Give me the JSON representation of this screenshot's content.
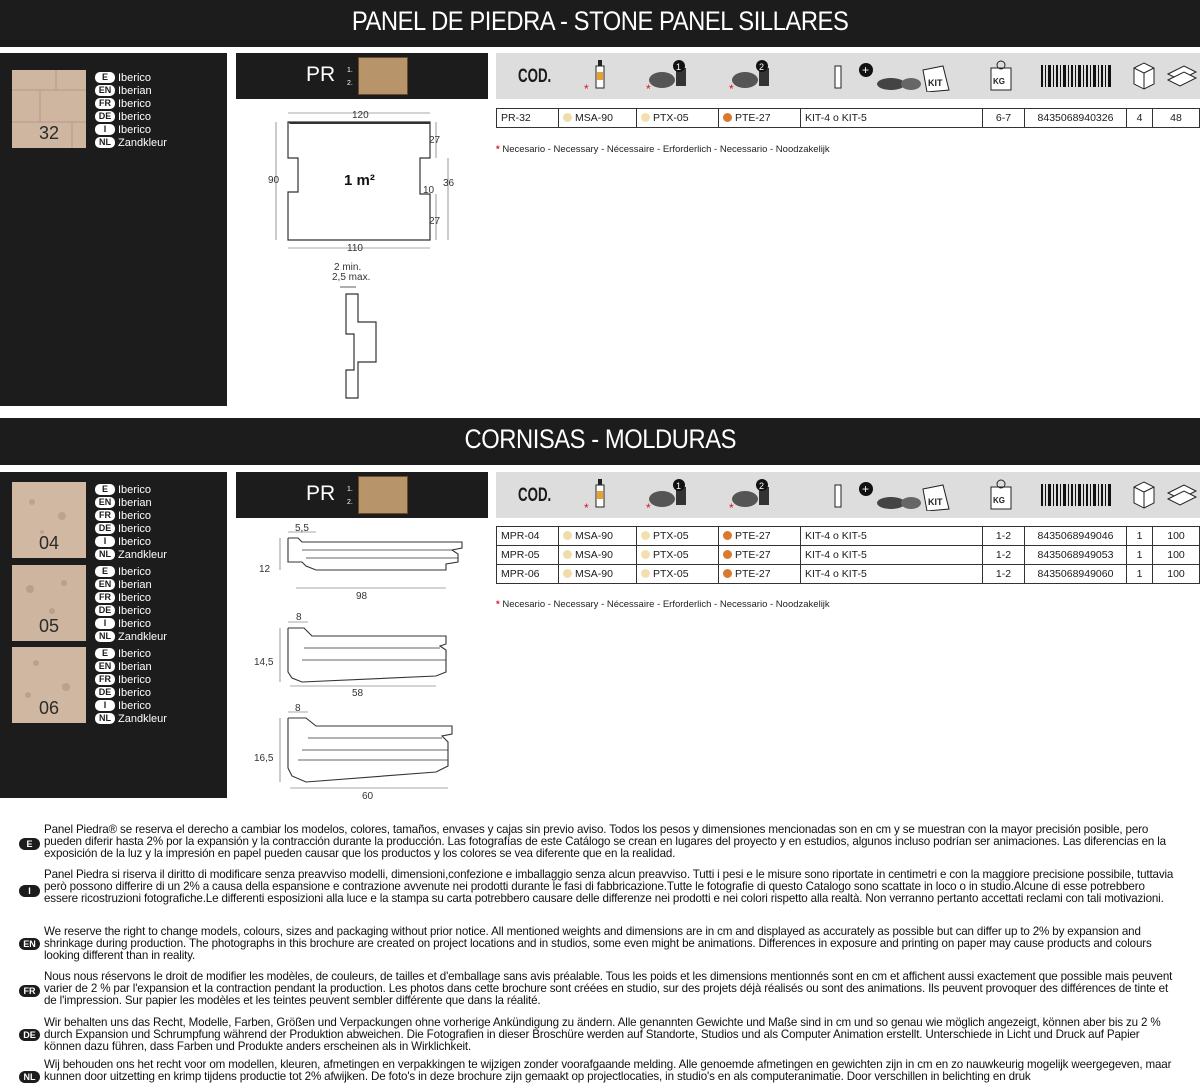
{
  "section1": {
    "title": "PANEL DE PIEDRA - STONE PANEL SILLARES",
    "swatch": {
      "number": "32"
    },
    "languages": [
      {
        "code": "E",
        "name": "Iberico"
      },
      {
        "code": "EN",
        "name": "Iberian"
      },
      {
        "code": "FR",
        "name": "Iberico"
      },
      {
        "code": "DE",
        "name": "Iberico"
      },
      {
        "code": "I",
        "name": "Iberico"
      },
      {
        "code": "NL",
        "name": "Zandkleur"
      }
    ],
    "pr_label": "PR",
    "pr_markers": [
      "1.",
      "2."
    ],
    "drawing": {
      "area": "1 m²",
      "width_top": "120",
      "width_bottom": "110",
      "height": "90",
      "right_top": "27",
      "right_mid": "36",
      "right_inner": "10",
      "right_bottom": "27",
      "joint_min": "2 min.",
      "joint_max": "2,5 max."
    },
    "rows": [
      {
        "code": "PR-32",
        "c1": "MSA-90",
        "c2": "PTX-05",
        "c3": "PTE-27",
        "kit": "KIT-4 o KIT-5",
        "kg": "6-7",
        "ean": "8435068940326",
        "box": "4",
        "pallet": "48"
      }
    ],
    "footnote": "Necesario - Necessary - Nécessaire - Erforderlich - Necessario - Noodzakelijk"
  },
  "section2": {
    "title": "CORNISAS - MOLDURAS",
    "swatches": [
      {
        "number": "04"
      },
      {
        "number": "05"
      },
      {
        "number": "06"
      }
    ],
    "languages": [
      {
        "code": "E",
        "name": "Iberico"
      },
      {
        "code": "EN",
        "name": "Iberian"
      },
      {
        "code": "FR",
        "name": "Iberico"
      },
      {
        "code": "DE",
        "name": "Iberico"
      },
      {
        "code": "I",
        "name": "Iberico"
      },
      {
        "code": "NL",
        "name": "Zandkleur"
      }
    ],
    "pr_label": "PR",
    "pr_markers": [
      "1.",
      "2."
    ],
    "profiles": [
      {
        "top": "5,5",
        "height": "12",
        "length": "98"
      },
      {
        "top": "8",
        "height": "14,5",
        "length": "58"
      },
      {
        "top": "8",
        "height": "16,5",
        "length": "60"
      }
    ],
    "rows": [
      {
        "code": "MPR-04",
        "c1": "MSA-90",
        "c2": "PTX-05",
        "c3": "PTE-27",
        "kit": "KIT-4 o KIT-5",
        "kg": "1-2",
        "ean": "8435068949046",
        "box": "1",
        "pallet": "100"
      },
      {
        "code": "MPR-05",
        "c1": "MSA-90",
        "c2": "PTX-05",
        "c3": "PTE-27",
        "kit": "KIT-4 o KIT-5",
        "kg": "1-2",
        "ean": "8435068949053",
        "box": "1",
        "pallet": "100"
      },
      {
        "code": "MPR-06",
        "c1": "MSA-90",
        "c2": "PTX-05",
        "c3": "PTE-27",
        "kit": "KIT-4 o KIT-5",
        "kg": "1-2",
        "ean": "8435068949060",
        "box": "1",
        "pallet": "100"
      }
    ],
    "footnote": "Necesario - Necessary - Nécessaire - Erforderlich - Necessario - Noodzakelijk"
  },
  "icon_bar": {
    "cod": "COD.",
    "icons": [
      "adhesive-tube-icon",
      "paint-step-1-icon",
      "paint-step-2-icon",
      "kit-icon",
      "weight-icon",
      "barcode-icon",
      "box-icon",
      "pallet-icon"
    ],
    "kit_label": "KIT",
    "kg_label": "KG",
    "step1": "1",
    "step2": "2"
  },
  "colors": {
    "dark": "#1c1c1c",
    "msa": "#f0dca8",
    "ptx": "#f2e0b0",
    "pte": "#d9792e",
    "required": "#dd1122"
  },
  "disclaimers": [
    {
      "code": "E",
      "text": "Panel Piedra® se reserva el derecho a cambiar los modelos, colores, tamaños, envases y cajas sin previo aviso. Todos los pesos y dimensiones mencionadas son en cm y se muestran con la mayor precisión posible, pero pueden diferir hasta 2% por la expansión y la contracción durante la producción. Las fotografías de este Catálogo se crean en lugares del proyecto y en estudios, algunos incluso podrían ser animaciones. Las diferencias en la exposición de la luz y la impresión en papel pueden causar que los productos y los colores se vea diferente que en la realidad."
    },
    {
      "code": "I",
      "text": "Panel Piedra si riserva il diritto di modificare senza preavviso modelli, dimensioni,confezione e imballaggio senza alcun preavviso. Tutti i pesi e le misure sono riportate in centimetri e con la maggiore precisione possibile, tuttavia però possono differire di un 2% a causa della espansione e contrazione avvenute nei prodotti durante le fasi di fabbricazione.Tutte le fotografie di questo Catalogo sono scattate in loco o in studio.Alcune di esse potrebbero essere ricostruzioni fotografiche.Le differenti esposizioni alla luce e la stampa su carta potrebbero causare delle differenze nei prodotti e nei colori rispetto alla realtà. Non verranno pertanto accettati reclami con tali motivazioni."
    },
    {
      "code": "EN",
      "text": "We reserve the right to change models, colours, sizes and packaging without prior notice. All mentioned weights and dimensions are in cm and displayed as accurately as possible but can differ up to 2% by expansion and shrinkage during production. The photographs in this brochure are created on project locations and in studios, some even might be animations. Differences in exposure and printing on paper may cause products and colours looking different than in reality."
    },
    {
      "code": "FR",
      "text": "Nous nous réservons le droit de modifier les modèles, de couleurs, de tailles et d'emballage sans avis préalable. Tous les poids et les dimensions mentionnés sont en cm et affichent aussi exactement que possible mais peuvent varier de 2 % par l'expansion et la contraction pendant la production. Les photos dans cette brochure sont créées en studio, sur des projets déjà réalisés ou sont des animations. Ils peuvent provoquer des différences de tinte et de l'impression. Sur papier les modèles et les teintes peuvent sembler différente que dans la réalité."
    },
    {
      "code": "DE",
      "text": "Wir behalten uns das Recht, Modelle, Farben, Größen und Verpackungen ohne vorherige Ankündigung zu ändern. Alle genannten Gewichte und Maße sind in cm und so genau wie möglich angezeigt, können aber bis zu 2 % durch Expansion und Schrumpfung während der Produktion abweichen. Die Fotografien in dieser Broschüre werden auf Standorte, Studios und als Computer Animation erstellt. Unterschiede in Licht und Druck auf Papier können dazu führen, dass Farben und Produkte anders erscheinen als in Wirklichkeit."
    },
    {
      "code": "NL",
      "text": "Wij behouden ons het recht voor om modellen, kleuren, afmetingen en verpakkingen te wijzigen zonder voorafgaande melding. Alle genoemde afmetingen en gewichten zijn in cm en zo nauwkeurig mogelijk weergegeven, maar kunnen door uitzetting en krimp tijdens productie tot 2% afwijken. De foto's in deze brochure zijn gemaakt op projectlocaties, in studio's en als computeranimatie. Door verschillen in belichting en druk"
    }
  ]
}
